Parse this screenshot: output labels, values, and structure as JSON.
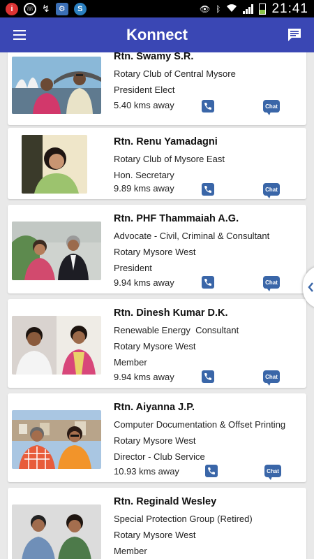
{
  "status_bar": {
    "time": "21:41"
  },
  "app_bar": {
    "title": "Konnect"
  },
  "members": [
    {
      "name": "Rtn. Swamy S.R.",
      "lines": [
        "Rotary Club of Central Mysore",
        "President Elect"
      ],
      "distance": "5.40 kms away",
      "chat_label": "Chat"
    },
    {
      "name": "Rtn. Renu Yamadagni",
      "lines": [
        "Rotary Club of Mysore East",
        "Hon. Secretary"
      ],
      "distance": "9.89 kms away",
      "chat_label": "Chat"
    },
    {
      "name": "Rtn. PHF Thammaiah A.G.",
      "lines": [
        "Advocate - Civil, Criminal & Consultant",
        "Rotary Mysore West",
        "President"
      ],
      "distance": "9.94 kms away",
      "chat_label": "Chat"
    },
    {
      "name": "Rtn. Dinesh Kumar D.K.",
      "lines": [
        "Renewable Energy  Consultant",
        "Rotary Mysore West",
        "Member"
      ],
      "distance": "9.94 kms away",
      "chat_label": "Chat"
    },
    {
      "name": "Rtn. Aiyanna J.P.",
      "lines": [
        "Computer Documentation & Offset Printing",
        "Rotary Mysore West",
        "Director - Club Service"
      ],
      "distance": "10.93 kms away",
      "chat_label": "Chat"
    },
    {
      "name": "Rtn. Reginald Wesley",
      "lines": [
        "Special Protection Group (Retired)",
        "Rotary Mysore West",
        "Member"
      ],
      "distance": "",
      "chat_label": ""
    }
  ]
}
